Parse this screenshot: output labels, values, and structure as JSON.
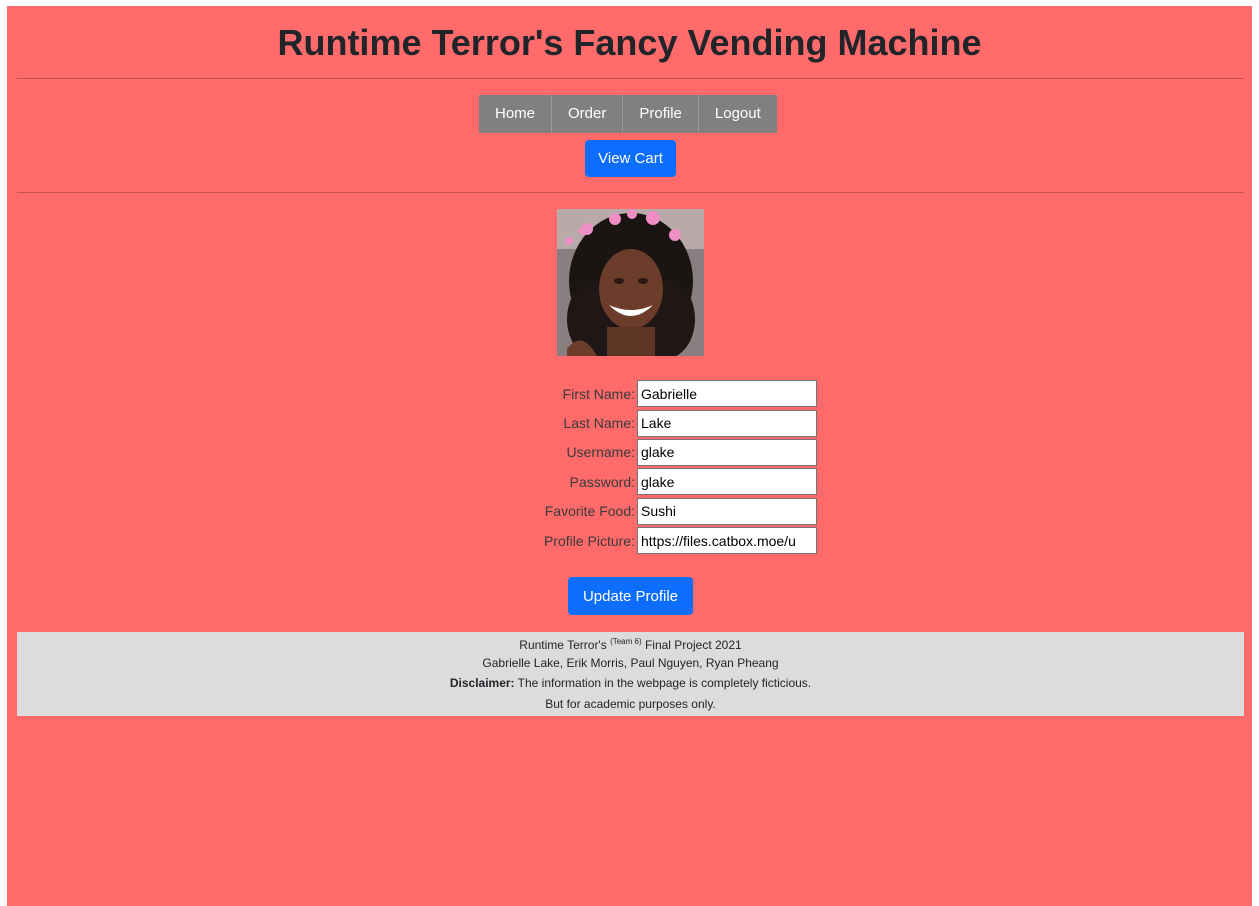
{
  "header": {
    "title": "Runtime Terror's Fancy Vending Machine"
  },
  "nav": {
    "items": [
      {
        "label": "Home"
      },
      {
        "label": "Order"
      },
      {
        "label": "Profile"
      },
      {
        "label": "Logout"
      }
    ],
    "view_cart_label": "View Cart"
  },
  "profile": {
    "fields": [
      {
        "label": "First Name:",
        "value": "Gabrielle"
      },
      {
        "label": "Last Name:",
        "value": "Lake"
      },
      {
        "label": "Username:",
        "value": "glake"
      },
      {
        "label": "Password:",
        "value": "glake"
      },
      {
        "label": "Favorite Food:",
        "value": "Sushi"
      },
      {
        "label": "Profile Picture:",
        "value": "https://files.catbox.moe/u"
      }
    ],
    "update_label": "Update Profile"
  },
  "footer": {
    "project_prefix": "Runtime Terror's ",
    "team_sup": "(Team 6)",
    "project_suffix": " Final Project 2021",
    "members": "Gabrielle Lake, Erik Morris, Paul Nguyen, Ryan Pheang",
    "disclaimer_label": "Disclaimer:",
    "disclaimer_text": " The information in the webpage is completely ficticious.",
    "note": "But for academic purposes only."
  },
  "colors": {
    "page_background": "#ff6b6b",
    "nav_background": "#808080",
    "button_primary": "#0d6efd",
    "footer_background": "#dcdcdc"
  }
}
